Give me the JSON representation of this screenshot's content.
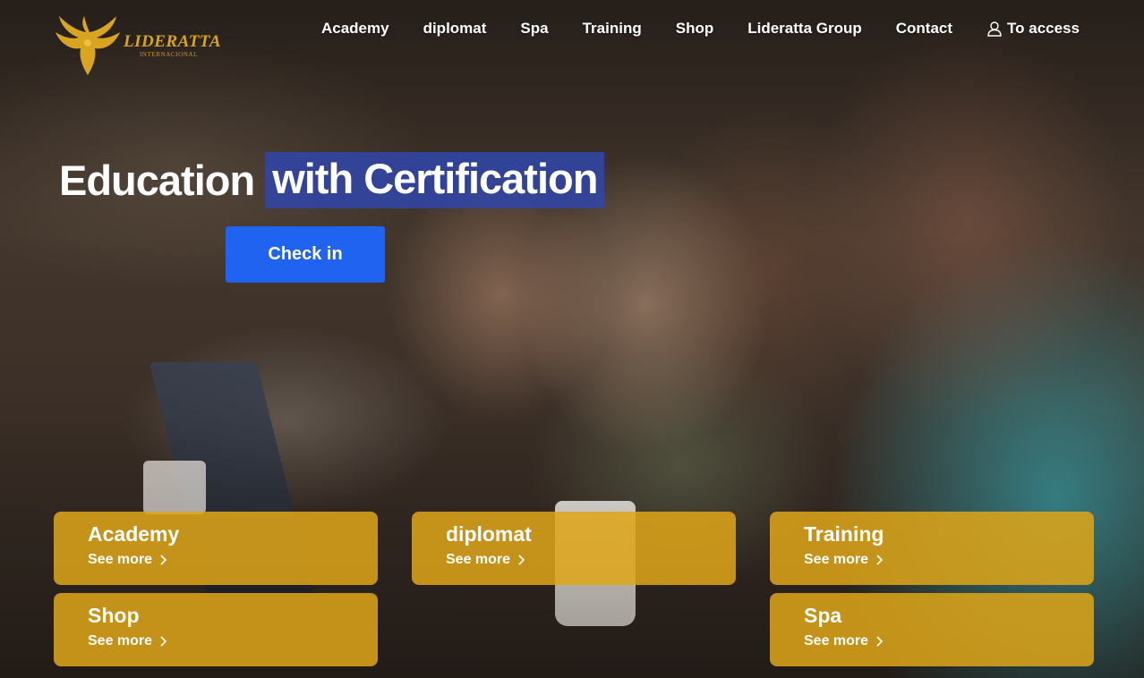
{
  "brand": {
    "name": "LIDERATTA",
    "tagline": "INTERNACIONAL",
    "gold": "#d9a520"
  },
  "nav": {
    "items": [
      "Academy",
      "diplomat",
      "Spa",
      "Training",
      "Shop",
      "Lideratta Group",
      "Contact"
    ],
    "access_label": "To access",
    "access_icon": "user-icon"
  },
  "hero": {
    "title_part1": "Education",
    "title_part2": "with Certification",
    "highlight_color": "#3046aa",
    "cta_label": "Check in",
    "cta_color": "#1f63f0"
  },
  "cards": [
    {
      "title": "Academy",
      "link": "See more"
    },
    {
      "title": "diplomat",
      "link": "See more"
    },
    {
      "title": "Training",
      "link": "See more"
    },
    {
      "title": "Shop",
      "link": "See more"
    },
    {
      "title": "Spa",
      "link": "See more"
    }
  ],
  "card_color": "#dea519"
}
